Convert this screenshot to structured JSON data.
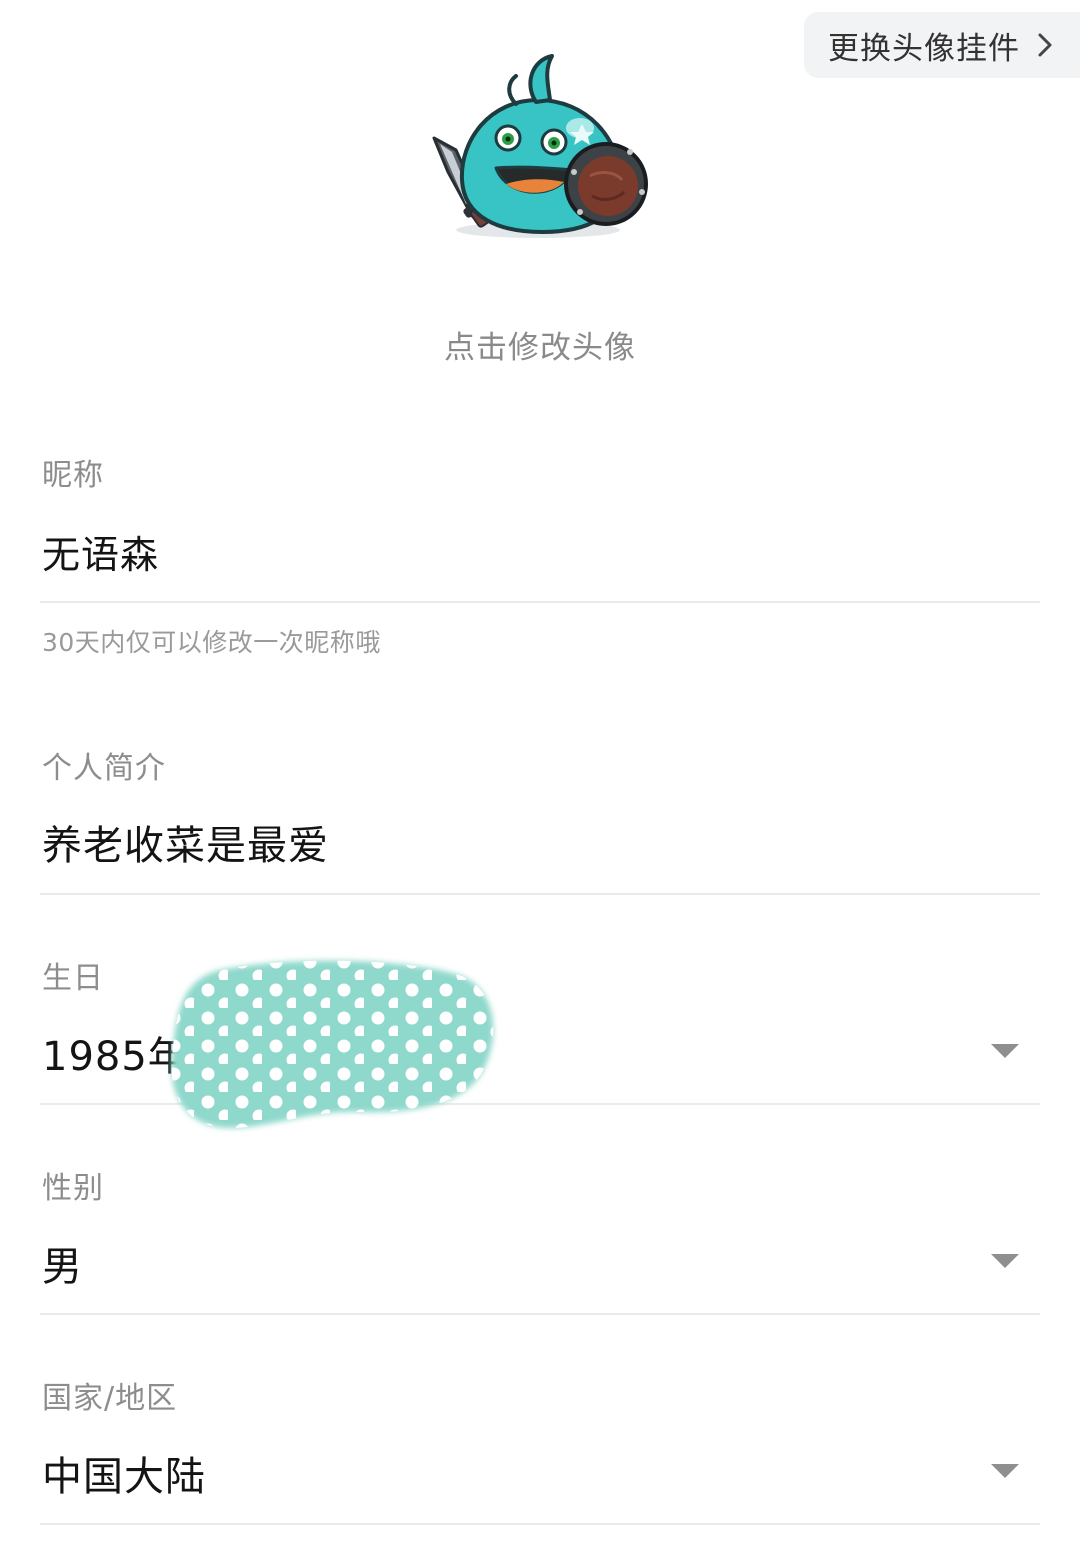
{
  "header": {
    "change_pendant_label": "更换头像挂件"
  },
  "avatar": {
    "hint": "点击修改头像"
  },
  "nickname": {
    "label": "昵称",
    "value": "无语森",
    "note": "30天内仅可以修改一次昵称哦"
  },
  "bio": {
    "label": "个人简介",
    "value": "养老收菜是最爱"
  },
  "birthday": {
    "label": "生日",
    "value": "1985年"
  },
  "gender": {
    "label": "性别",
    "value": "男"
  },
  "region": {
    "label": "国家/地区",
    "value": "中国大陆"
  },
  "colors": {
    "accent_teal": "#8fd8cc",
    "label_gray": "#8d8d8d",
    "divider": "#ebebeb",
    "pendant_bg": "#f2f3f5"
  }
}
